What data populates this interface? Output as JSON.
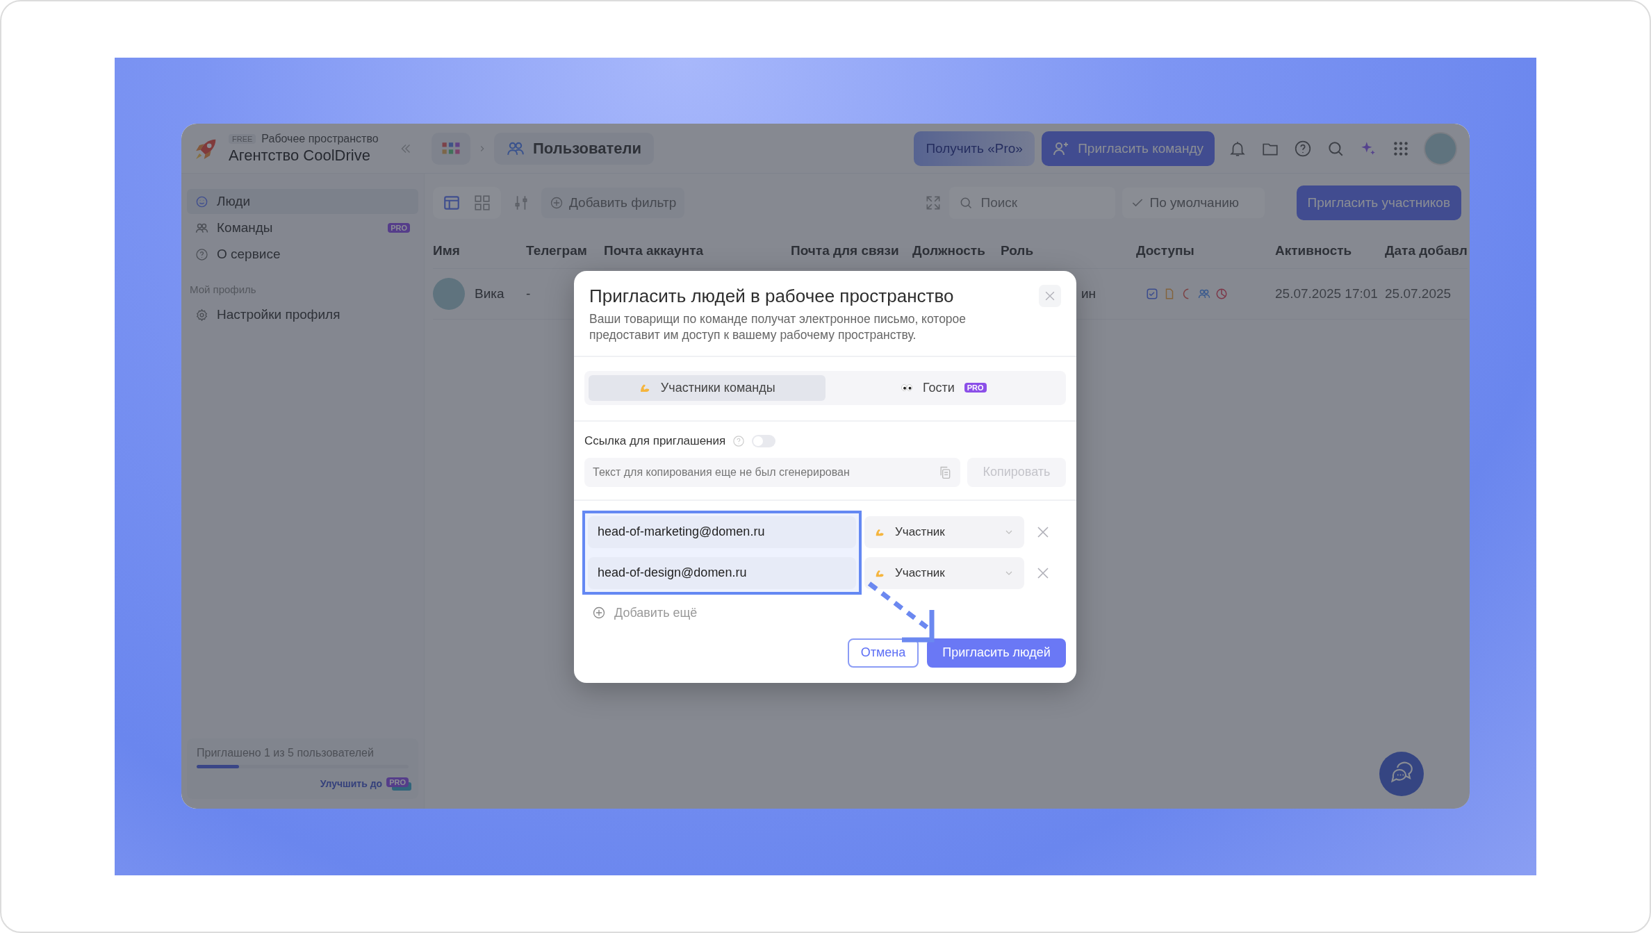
{
  "header": {
    "workspace": {
      "plan_badge": "FREE",
      "label": "Рабочее пространство",
      "name": "Агентство CoolDrive"
    },
    "breadcrumb": {
      "page": "Пользователи"
    },
    "buttons": [
      {
        "label": "Получить «Pro»",
        "kind": "upgrade"
      },
      {
        "label": "Пригласить команду",
        "kind": "primary"
      }
    ]
  },
  "sidebar": {
    "items": [
      {
        "label": "Люди",
        "selected": true,
        "kind": "people"
      },
      {
        "label": "Команды",
        "selected": false,
        "kind": "teams",
        "badge": "PRO"
      },
      {
        "label": "О сервисе",
        "selected": false,
        "kind": "about"
      }
    ],
    "section": "Мой профиль",
    "profile_items": [
      {
        "label": "Настройки профиля",
        "selected": false,
        "kind": "settings"
      }
    ],
    "usage": {
      "text": "Приглашено 1 из 5 пользователей",
      "level": 0.2,
      "upgrade_link": "Улучшить до",
      "badge": "PRO"
    }
  },
  "toolbar": {
    "filter_button": "Добавить фильтр",
    "search": {
      "placeholder": "Поиск"
    },
    "sort": "По умолчанию",
    "invite_button": "Пригласить участников"
  },
  "table": {
    "columns": [
      "Имя",
      "Телеграм",
      "Почта аккаунта",
      "Почта для связи",
      "Должность",
      "Роль",
      "Доступы",
      "Активность",
      "Дата добавл"
    ],
    "rows": [
      {
        "name": "Вика",
        "telegram": "-",
        "role": "ин",
        "activity": "25.07.2025 17:01",
        "date_added": "25.07.2025"
      }
    ]
  },
  "modal": {
    "title": "Пригласить людей в рабочее пространство",
    "description": "Ваши товарищи по команде получат электронное письмо, которое предоставит им доступ к вашему рабочему пространству.",
    "tabs": [
      {
        "label": "Участники команды",
        "selected": true,
        "kind": "members"
      },
      {
        "label": "Гости",
        "selected": false,
        "kind": "guests",
        "badge": "PRO"
      }
    ],
    "invite_link": {
      "label": "Ссылка для приглашения",
      "on": false,
      "placeholder": "Текст для копирования еще не был сгенерирован",
      "copy_button": "Копировать",
      "copy_disabled": true
    },
    "invites": [
      {
        "email": "head-of-marketing@domen.ru",
        "role": "Участник"
      },
      {
        "email": "head-of-design@domen.ru",
        "role": "Участник"
      }
    ],
    "add_more": "Добавить ещё",
    "buttons": [
      {
        "label": "Отмена",
        "kind": "secondary"
      },
      {
        "label": "Пригласить людей",
        "kind": "primary"
      }
    ]
  }
}
